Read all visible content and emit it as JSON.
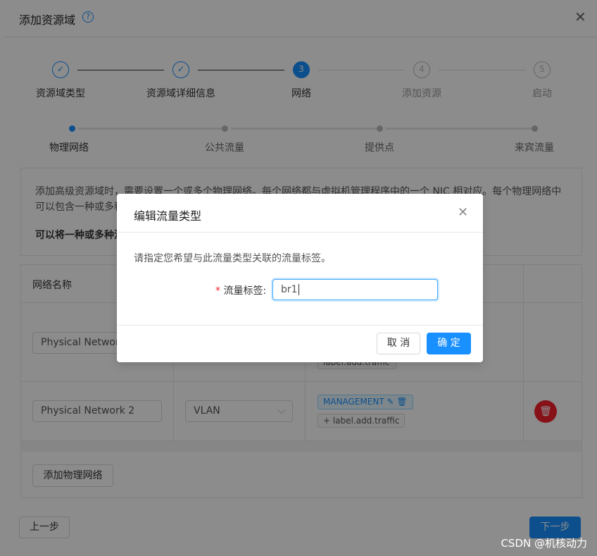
{
  "drawer": {
    "title": "添加资源域",
    "help_icon": "question-circle-icon",
    "close_icon": "close-icon"
  },
  "steps": [
    {
      "label": "资源域类型",
      "status": "done"
    },
    {
      "label": "资源域详细信息",
      "status": "done"
    },
    {
      "label": "网络",
      "number": "3",
      "status": "current"
    },
    {
      "label": "添加资源",
      "number": "4",
      "status": "todo"
    },
    {
      "label": "启动",
      "number": "5",
      "status": "todo"
    }
  ],
  "substeps": [
    {
      "label": "物理网络",
      "status": "current"
    },
    {
      "label": "公共流量",
      "status": "todo"
    },
    {
      "label": "提供点",
      "status": "todo"
    },
    {
      "label": "来宾流量",
      "status": "todo"
    }
  ],
  "info": {
    "line1": "添加高级资源域时，需要设置一个或多个物理网络。每个网络都与虚拟机管理程序中的一个 NIC 相对应。每个物理网络中",
    "line2": "可以包含一种或多种",
    "bold": "可以将一种或多种流"
  },
  "table": {
    "header": "网络名称",
    "rows": [
      {
        "name": "Physical Network",
        "traffic_add": "label.add.traffic"
      },
      {
        "name": "Physical Network 2",
        "isolation": "VLAN",
        "traffic_tag": "MANAGEMENT",
        "traffic_add": "label.add.traffic"
      }
    ],
    "add_button": "添加物理网络"
  },
  "footer": {
    "prev": "上一步",
    "next": "下一步"
  },
  "modal": {
    "title": "编辑流量类型",
    "description": "请指定您希望与此流量类型关联的流量标签。",
    "field_label": "流量标签",
    "required_mark": "*",
    "field_value": "br1",
    "cancel": "取 消",
    "ok": "确 定"
  },
  "colors": {
    "primary": "#1890ff",
    "danger": "#f5222d"
  },
  "watermark": "CSDN @机核动力"
}
